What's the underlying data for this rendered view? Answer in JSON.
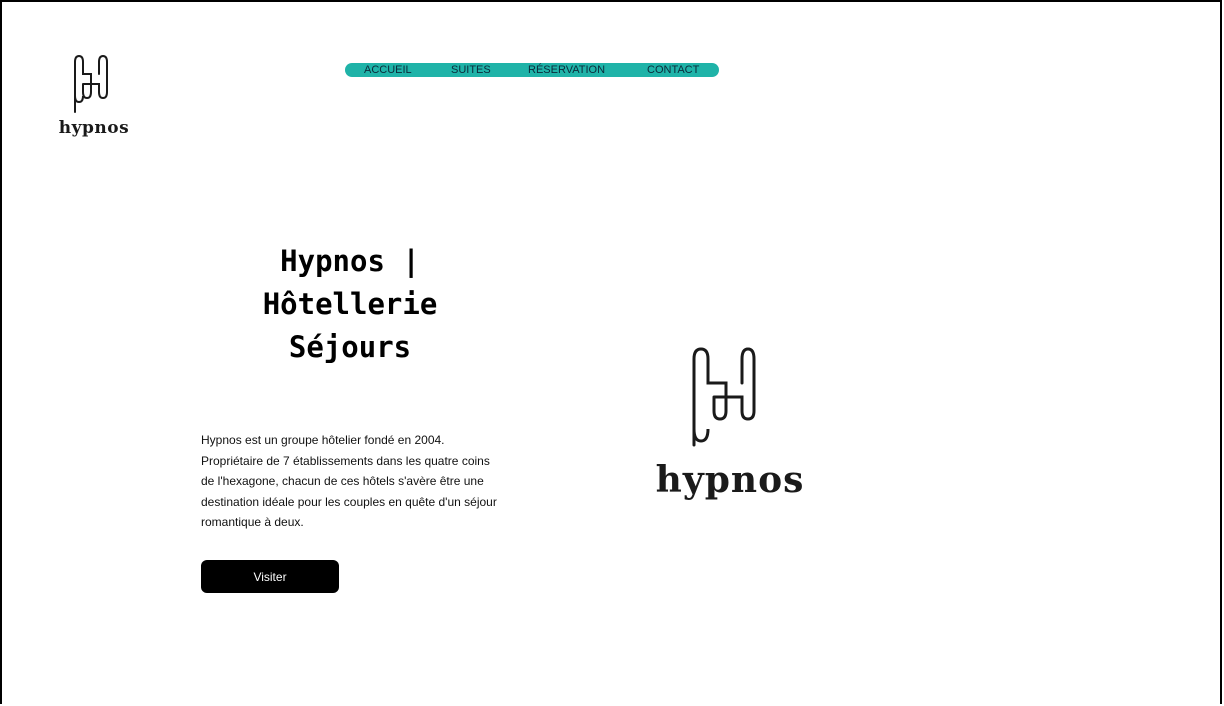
{
  "nav": {
    "items": [
      {
        "label": "ACCUEIL"
      },
      {
        "label": "SUITES"
      },
      {
        "label": "RÉSERVATION"
      },
      {
        "label": "CONTACT"
      }
    ]
  },
  "brand": {
    "wordmark": "hypnos"
  },
  "hero": {
    "title_lines": [
      "Hypnos |",
      "Hôtellerie",
      "Séjours"
    ],
    "description_lines": [
      "Hypnos est un groupe hôtelier fondé en 2004.",
      "Propriétaire de 7 établissements dans les quatre coins",
      "de l'hexagone, chacun de ces hôtels s'avère être une",
      "destination idéale pour les couples en quête d'un séjour",
      "romantique à deux."
    ],
    "cta_label": "Visiter"
  },
  "colors": {
    "nav_bg": "#1fb3a8",
    "button_bg": "#000000",
    "logo_stroke": "#1a1a1a"
  },
  "icons": {
    "logo_mark": "hypnos-h-monogram-icon"
  }
}
